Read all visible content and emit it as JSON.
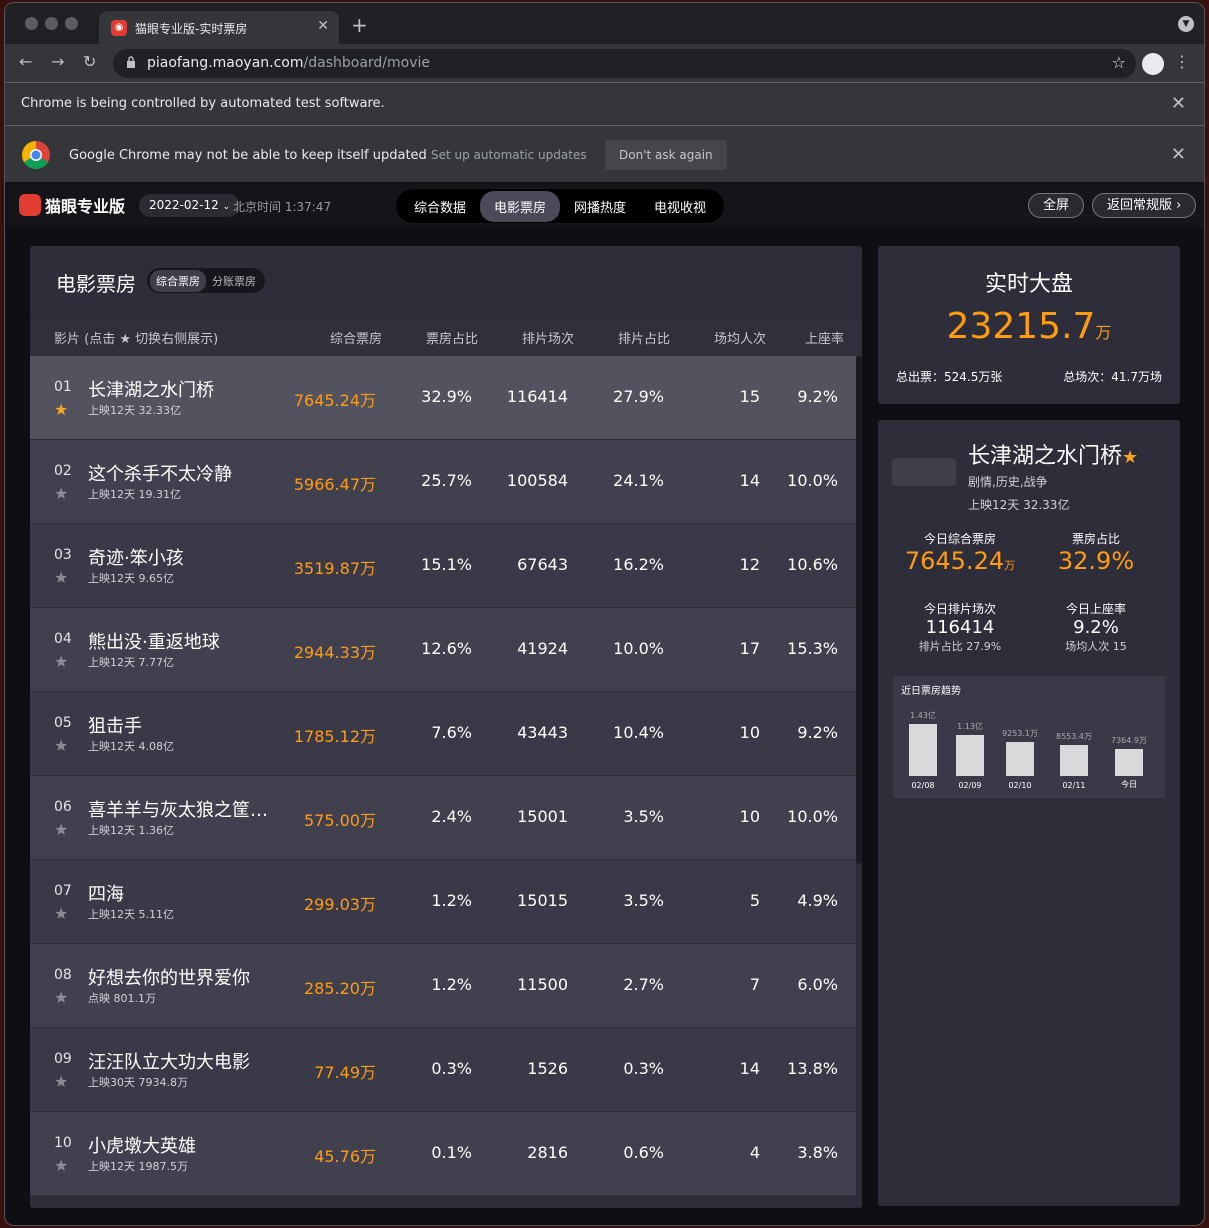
{
  "browser": {
    "tab_title": "猫眼专业版-实时票房",
    "url_host": "piaofang.maoyan.com",
    "url_path": "/dashboard/movie",
    "automation_notice": "Chrome is being controlled by automated test software.",
    "update_notice": "Google Chrome may not be able to keep itself updated",
    "setup_updates": "Set up automatic updates",
    "dont_ask": "Don't ask again"
  },
  "header": {
    "logo": "猫眼专业版",
    "date": "2022-02-12",
    "clock": "北京时间 1:37:47",
    "tabs": [
      "综合数据",
      "电影票房",
      "网播热度",
      "电视收视"
    ],
    "active_tab": "电影票房",
    "fullscreen": "全屏",
    "back": "返回常规版 ›"
  },
  "board": {
    "title": "电影票房",
    "toggle": [
      "综合票房",
      "分账票房"
    ],
    "columns": [
      "影片 (点击 ★ 切换右侧展示)",
      "综合票房",
      "票房占比",
      "排片场次",
      "排片占比",
      "场均人次",
      "上座率"
    ],
    "rows": [
      {
        "rank": "01",
        "name": "长津湖之水门桥",
        "sub": "上映12天  32.33亿",
        "box": "7645.24万",
        "share": "32.9%",
        "shows": "116414",
        "show_share": "27.9%",
        "avg": "15",
        "occ": "9.2%",
        "starred": true
      },
      {
        "rank": "02",
        "name": "这个杀手不太冷静",
        "sub": "上映12天  19.31亿",
        "box": "5966.47万",
        "share": "25.7%",
        "shows": "100584",
        "show_share": "24.1%",
        "avg": "14",
        "occ": "10.0%",
        "starred": false
      },
      {
        "rank": "03",
        "name": "奇迹·笨小孩",
        "sub": "上映12天  9.65亿",
        "box": "3519.87万",
        "share": "15.1%",
        "shows": "67643",
        "show_share": "16.2%",
        "avg": "12",
        "occ": "10.6%",
        "starred": false
      },
      {
        "rank": "04",
        "name": "熊出没·重返地球",
        "sub": "上映12天  7.77亿",
        "box": "2944.33万",
        "share": "12.6%",
        "shows": "41924",
        "show_share": "10.0%",
        "avg": "17",
        "occ": "15.3%",
        "starred": false
      },
      {
        "rank": "05",
        "name": "狙击手",
        "sub": "上映12天  4.08亿",
        "box": "1785.12万",
        "share": "7.6%",
        "shows": "43443",
        "show_share": "10.4%",
        "avg": "10",
        "occ": "9.2%",
        "starred": false
      },
      {
        "rank": "06",
        "name": "喜羊羊与灰太狼之筐…",
        "sub": "上映12天  1.36亿",
        "box": "575.00万",
        "share": "2.4%",
        "shows": "15001",
        "show_share": "3.5%",
        "avg": "10",
        "occ": "10.0%",
        "starred": false
      },
      {
        "rank": "07",
        "name": "四海",
        "sub": "上映12天  5.11亿",
        "box": "299.03万",
        "share": "1.2%",
        "shows": "15015",
        "show_share": "3.5%",
        "avg": "5",
        "occ": "4.9%",
        "starred": false
      },
      {
        "rank": "08",
        "name": "好想去你的世界爱你",
        "sub": "点映  801.1万",
        "box": "285.20万",
        "share": "1.2%",
        "shows": "11500",
        "show_share": "2.7%",
        "avg": "7",
        "occ": "6.0%",
        "starred": false
      },
      {
        "rank": "09",
        "name": "汪汪队立大功大电影",
        "sub": "上映30天  7934.8万",
        "box": "77.49万",
        "share": "0.3%",
        "shows": "1526",
        "show_share": "0.3%",
        "avg": "14",
        "occ": "13.8%",
        "starred": false
      },
      {
        "rank": "10",
        "name": "小虎墩大英雄",
        "sub": "上映12天  1987.5万",
        "box": "45.76万",
        "share": "0.1%",
        "shows": "2816",
        "show_share": "0.6%",
        "avg": "4",
        "occ": "3.8%",
        "starred": false
      }
    ]
  },
  "realtime": {
    "title": "实时大盘",
    "value": "23215.7",
    "unit": "万",
    "tickets": "总出票：524.5万张",
    "shows": "总场次：41.7万场"
  },
  "detail": {
    "title": "长津湖之水门桥",
    "genre": "剧情,历史,战争",
    "release": "上映12天  32.33亿",
    "today_box_label": "今日综合票房",
    "today_box": "7645.24",
    "today_box_unit": "万",
    "share_label": "票房占比",
    "share": "32.9%",
    "shows_label": "今日排片场次",
    "shows": "116414",
    "shows_share": "排片占比 27.9%",
    "occ_label": "今日上座率",
    "occ": "9.2%",
    "avg": "场均人次 15",
    "trend_title": "近日票房趋势",
    "trend": [
      {
        "date": "02/08",
        "label": "1.43亿",
        "value": 14300
      },
      {
        "date": "02/09",
        "label": "1.13亿",
        "value": 11300
      },
      {
        "date": "02/10",
        "label": "9253.1万",
        "value": 9253.1
      },
      {
        "date": "02/11",
        "label": "8553.4万",
        "value": 8553.4
      },
      {
        "date": "今日",
        "label": "7364.9万",
        "value": 7364.9
      }
    ]
  }
}
